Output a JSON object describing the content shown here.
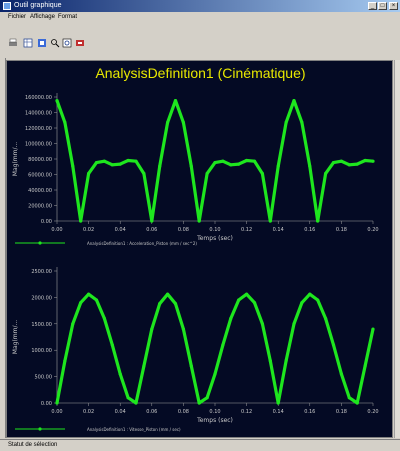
{
  "window": {
    "title": "Outil graphique"
  },
  "menu": [
    "Fichier",
    "Affichage",
    "Format"
  ],
  "toolbar": {
    "icons": [
      "print-icon",
      "table-icon",
      "export-icon",
      "zoom-icon",
      "fit-icon",
      "settings-icon"
    ]
  },
  "chart_title": "AnalysisDefinition1 (Cinématique)",
  "status": "Statut de sélection",
  "colors": {
    "background": "#040a24",
    "curve": "#1ee61e",
    "title": "#e8e800",
    "axis_text": "#c8c8c8"
  },
  "chart_data": [
    {
      "type": "line",
      "xlabel": "Temps (sec)",
      "ylabel": "Mag(mm/...",
      "x_ticks": [
        "0.00",
        "0.02",
        "0.04",
        "0.06",
        "0.08",
        "0.10",
        "0.12",
        "0.14",
        "0.16",
        "0.18",
        "0.20"
      ],
      "y_ticks": [
        "0.00",
        "20000.00",
        "40000.00",
        "60000.00",
        "80000.00",
        "100000.00",
        "120000.00",
        "140000.00",
        "160000.00"
      ],
      "xlim": [
        0,
        0.2
      ],
      "ylim": [
        0,
        170000
      ],
      "legend": "AnalysisDefinition1 : Acceleration_Piston (mm / sec^2)",
      "series": [
        {
          "name": "AnalysisDefinition1 : Acceleration_Piston (mm / sec^2)",
          "x": [
            0,
            0.005,
            0.01,
            0.015,
            0.02,
            0.025,
            0.03,
            0.035,
            0.04,
            0.045,
            0.05,
            0.055,
            0.06,
            0.065,
            0.07,
            0.075,
            0.08,
            0.085,
            0.09,
            0.095,
            0.1,
            0.105,
            0.11,
            0.115,
            0.12,
            0.125,
            0.13,
            0.135,
            0.14,
            0.145,
            0.15,
            0.155,
            0.16,
            0.165,
            0.17,
            0.175,
            0.18,
            0.185,
            0.19,
            0.195,
            0.2
          ],
          "y": [
            165000,
            135000,
            75000,
            0,
            65000,
            80000,
            82000,
            77000,
            78000,
            83000,
            82000,
            65000,
            0,
            75000,
            135000,
            165000,
            135000,
            75000,
            0,
            65000,
            80000,
            82000,
            77000,
            78000,
            83000,
            82000,
            65000,
            0,
            75000,
            135000,
            165000,
            135000,
            75000,
            0,
            65000,
            80000,
            82000,
            77000,
            78000,
            83000,
            82000
          ]
        }
      ]
    },
    {
      "type": "line",
      "xlabel": "Temps (sec)",
      "ylabel": "Mag(mm/...",
      "x_ticks": [
        "0.00",
        "0.02",
        "0.04",
        "0.06",
        "0.08",
        "0.10",
        "0.12",
        "0.14",
        "0.16",
        "0.18",
        "0.20"
      ],
      "y_ticks": [
        "0.00",
        "500.00",
        "1000.00",
        "1500.00",
        "2000.00",
        "2500.00"
      ],
      "xlim": [
        0,
        0.2
      ],
      "ylim": [
        0,
        2500
      ],
      "legend": "AnalysisDefinition1 : Vitesse_Piston (mm / sec)",
      "series": [
        {
          "name": "AnalysisDefinition1 : Vitesse_Piston (mm / sec)",
          "x": [
            0,
            0.005,
            0.01,
            0.015,
            0.02,
            0.025,
            0.03,
            0.035,
            0.04,
            0.045,
            0.05,
            0.055,
            0.06,
            0.065,
            0.07,
            0.075,
            0.08,
            0.085,
            0.09,
            0.095,
            0.1,
            0.105,
            0.11,
            0.115,
            0.12,
            0.125,
            0.13,
            0.135,
            0.14,
            0.145,
            0.15,
            0.155,
            0.16,
            0.165,
            0.17,
            0.175,
            0.18,
            0.185,
            0.19,
            0.195,
            0.2
          ],
          "y": [
            0,
            800,
            1500,
            1900,
            2060,
            1950,
            1600,
            1100,
            550,
            100,
            0,
            700,
            1400,
            1880,
            2060,
            1880,
            1400,
            700,
            0,
            100,
            550,
            1100,
            1600,
            1950,
            2060,
            1900,
            1500,
            800,
            0,
            800,
            1500,
            1900,
            2060,
            1950,
            1600,
            1100,
            550,
            100,
            0,
            700,
            1400
          ]
        }
      ]
    }
  ]
}
